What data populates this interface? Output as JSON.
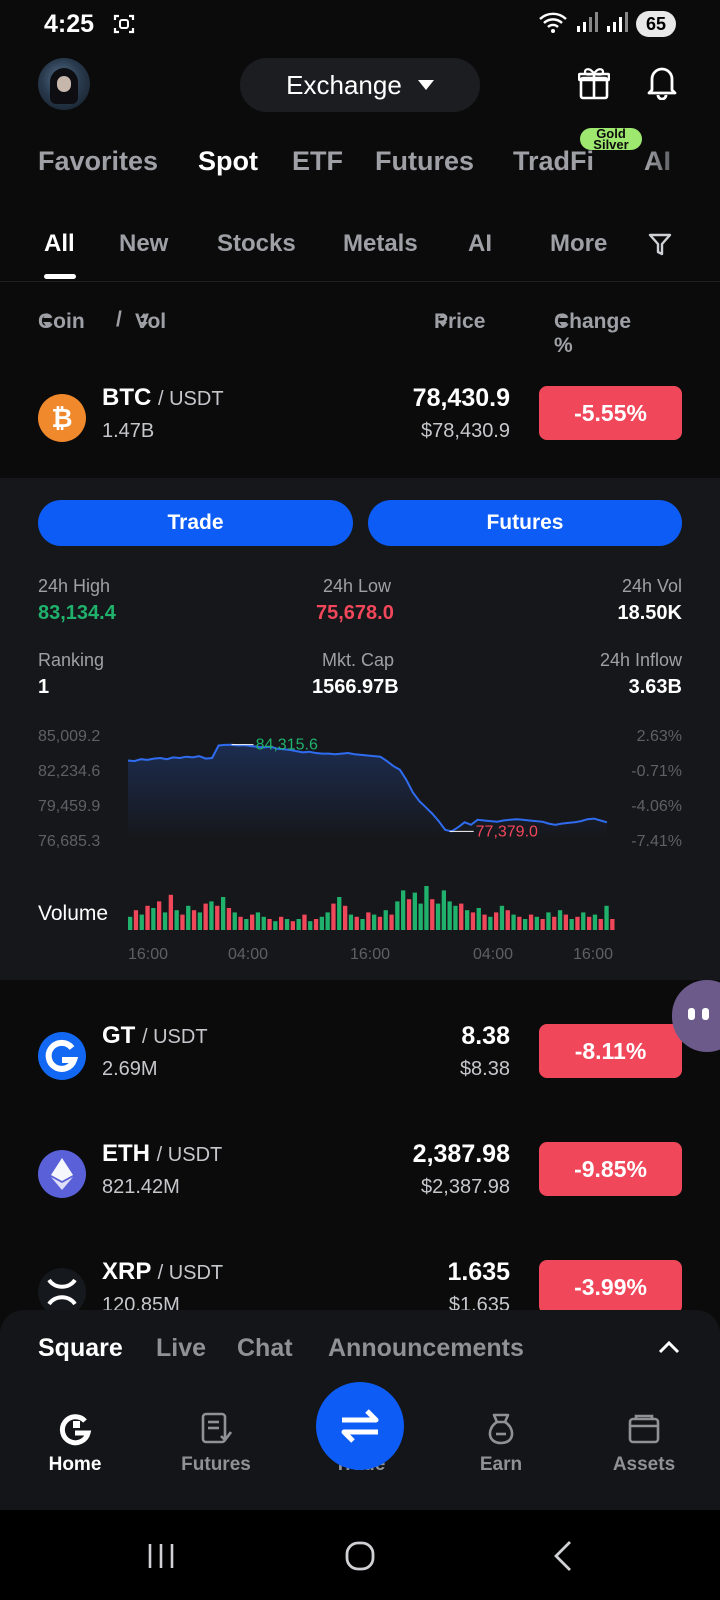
{
  "status_bar": {
    "time": "4:25",
    "battery": "65"
  },
  "header": {
    "exchange_label": "Exchange"
  },
  "main_tabs": [
    {
      "label": "Favorites",
      "active": false
    },
    {
      "label": "Spot",
      "active": true
    },
    {
      "label": "ETF",
      "active": false
    },
    {
      "label": "Futures",
      "active": false
    },
    {
      "label": "TradFi",
      "active": false
    },
    {
      "label": "AI",
      "active": false
    }
  ],
  "tradfi_badge": [
    "Gold",
    "Silver"
  ],
  "sub_tabs": [
    {
      "label": "All",
      "active": true
    },
    {
      "label": "New",
      "active": false
    },
    {
      "label": "Stocks",
      "active": false
    },
    {
      "label": "Metals",
      "active": false
    },
    {
      "label": "AI",
      "active": false
    },
    {
      "label": "More",
      "active": false
    }
  ],
  "columns": {
    "coin": "Coin",
    "separator": "/",
    "vol": "Vol",
    "price": "Price",
    "change": "Change %"
  },
  "rows": [
    {
      "base": "BTC",
      "quote": "/ USDT",
      "vol": "1.47B",
      "price": "78,430.9",
      "price_usd": "$78,430.9",
      "change": "-5.55%"
    },
    {
      "base": "GT",
      "quote": "/ USDT",
      "vol": "2.69M",
      "price": "8.38",
      "price_usd": "$8.38",
      "change": "-8.11%"
    },
    {
      "base": "ETH",
      "quote": "/ USDT",
      "vol": "821.42M",
      "price": "2,387.98",
      "price_usd": "$2,387.98",
      "change": "-9.85%"
    },
    {
      "base": "XRP",
      "quote": "/ USDT",
      "vol": "120.85M",
      "price": "1.635",
      "price_usd": "$1.635",
      "change": "-3.99%"
    }
  ],
  "detail": {
    "trade_label": "Trade",
    "futures_label": "Futures",
    "stats": {
      "high_label": "24h High",
      "high_value": "83,134.4",
      "low_label": "24h Low",
      "low_value": "75,678.0",
      "vol_label": "24h Vol",
      "vol_value": "18.50K",
      "rank_label": "Ranking",
      "rank_value": "1",
      "cap_label": "Mkt. Cap",
      "cap_value": "1566.97B",
      "inflow_label": "24h Inflow",
      "inflow_value": "3.63B"
    },
    "colors": {
      "up": "#20b26c",
      "down": "#f1475a",
      "line": "#2f6cf0"
    }
  },
  "chart_data": {
    "type": "line",
    "series": [
      {
        "values": [
          83050,
          83000,
          83150,
          83100,
          83200,
          83250,
          83150,
          83300,
          83250,
          83350,
          83300,
          83400,
          83200,
          83250,
          84250,
          84300,
          84315.6,
          84250,
          84280,
          84200,
          84150,
          84100,
          84150,
          84000,
          83950,
          83900,
          83800,
          83700,
          83750,
          83650,
          83600,
          83600,
          83550,
          83600,
          83650,
          83550,
          83500,
          83450,
          83400,
          83350,
          83000,
          82600,
          82300,
          81500,
          80500,
          79800,
          79300,
          78800,
          78200,
          77500,
          77379.0,
          77700,
          78100,
          77900,
          78300,
          78250,
          78200,
          78150,
          78250,
          78300,
          78350,
          78300,
          78250,
          78200,
          78150,
          78000,
          77900,
          78000,
          78050,
          78100,
          78200,
          78350,
          78400,
          78250,
          78100
        ]
      }
    ],
    "y_ticks": [
      "85,009.2",
      "82,234.6",
      "79,459.9",
      "76,685.3"
    ],
    "pct_ticks": [
      "2.63%",
      "-0.71%",
      "-4.06%",
      "-7.41%"
    ],
    "ylim": [
      76685.3,
      85009.2
    ],
    "x_ticks": [
      "16:00",
      "04:00",
      "16:00",
      "04:00",
      "16:00"
    ],
    "high_marker": "84,315.6",
    "low_marker": "77,379.0",
    "volume_label": "Volume",
    "volume": [
      {
        "v": 0.3,
        "up": true
      },
      {
        "v": 0.45,
        "up": false
      },
      {
        "v": 0.35,
        "up": true
      },
      {
        "v": 0.55,
        "up": false
      },
      {
        "v": 0.5,
        "up": true
      },
      {
        "v": 0.65,
        "up": false
      },
      {
        "v": 0.4,
        "up": true
      },
      {
        "v": 0.8,
        "up": false
      },
      {
        "v": 0.45,
        "up": true
      },
      {
        "v": 0.35,
        "up": false
      },
      {
        "v": 0.55,
        "up": true
      },
      {
        "v": 0.45,
        "up": false
      },
      {
        "v": 0.4,
        "up": true
      },
      {
        "v": 0.6,
        "up": false
      },
      {
        "v": 0.65,
        "up": true
      },
      {
        "v": 0.55,
        "up": false
      },
      {
        "v": 0.75,
        "up": true
      },
      {
        "v": 0.5,
        "up": false
      },
      {
        "v": 0.4,
        "up": true
      },
      {
        "v": 0.3,
        "up": false
      },
      {
        "v": 0.25,
        "up": true
      },
      {
        "v": 0.35,
        "up": false
      },
      {
        "v": 0.4,
        "up": true
      },
      {
        "v": 0.3,
        "up": true
      },
      {
        "v": 0.25,
        "up": false
      },
      {
        "v": 0.2,
        "up": true
      },
      {
        "v": 0.3,
        "up": false
      },
      {
        "v": 0.25,
        "up": true
      },
      {
        "v": 0.2,
        "up": false
      },
      {
        "v": 0.25,
        "up": true
      },
      {
        "v": 0.35,
        "up": false
      },
      {
        "v": 0.2,
        "up": true
      },
      {
        "v": 0.25,
        "up": false
      },
      {
        "v": 0.3,
        "up": true
      },
      {
        "v": 0.4,
        "up": true
      },
      {
        "v": 0.6,
        "up": false
      },
      {
        "v": 0.75,
        "up": true
      },
      {
        "v": 0.55,
        "up": false
      },
      {
        "v": 0.35,
        "up": true
      },
      {
        "v": 0.3,
        "up": false
      },
      {
        "v": 0.25,
        "up": true
      },
      {
        "v": 0.4,
        "up": false
      },
      {
        "v": 0.35,
        "up": true
      },
      {
        "v": 0.3,
        "up": false
      },
      {
        "v": 0.45,
        "up": true
      },
      {
        "v": 0.35,
        "up": false
      },
      {
        "v": 0.65,
        "up": true
      },
      {
        "v": 0.9,
        "up": true
      },
      {
        "v": 0.7,
        "up": false
      },
      {
        "v": 0.85,
        "up": true
      },
      {
        "v": 0.6,
        "up": true
      },
      {
        "v": 1.0,
        "up": true
      },
      {
        "v": 0.7,
        "up": false
      },
      {
        "v": 0.6,
        "up": true
      },
      {
        "v": 0.9,
        "up": true
      },
      {
        "v": 0.65,
        "up": true
      },
      {
        "v": 0.55,
        "up": true
      },
      {
        "v": 0.6,
        "up": false
      },
      {
        "v": 0.45,
        "up": true
      },
      {
        "v": 0.4,
        "up": false
      },
      {
        "v": 0.5,
        "up": true
      },
      {
        "v": 0.35,
        "up": false
      },
      {
        "v": 0.3,
        "up": true
      },
      {
        "v": 0.4,
        "up": false
      },
      {
        "v": 0.55,
        "up": true
      },
      {
        "v": 0.45,
        "up": false
      },
      {
        "v": 0.35,
        "up": true
      },
      {
        "v": 0.3,
        "up": false
      },
      {
        "v": 0.25,
        "up": true
      },
      {
        "v": 0.35,
        "up": false
      },
      {
        "v": 0.3,
        "up": true
      },
      {
        "v": 0.25,
        "up": false
      },
      {
        "v": 0.4,
        "up": true
      },
      {
        "v": 0.3,
        "up": false
      },
      {
        "v": 0.45,
        "up": true
      },
      {
        "v": 0.35,
        "up": false
      },
      {
        "v": 0.25,
        "up": true
      },
      {
        "v": 0.3,
        "up": false
      },
      {
        "v": 0.4,
        "up": true
      },
      {
        "v": 0.3,
        "up": false
      },
      {
        "v": 0.35,
        "up": true
      },
      {
        "v": 0.25,
        "up": false
      },
      {
        "v": 0.55,
        "up": true
      },
      {
        "v": 0.25,
        "up": false
      }
    ]
  },
  "feed_tabs": [
    {
      "label": "Square",
      "active": true
    },
    {
      "label": "Live",
      "active": false
    },
    {
      "label": "Chat",
      "active": false
    },
    {
      "label": "Announcements",
      "active": false
    }
  ],
  "bottom_nav": [
    {
      "label": "Home",
      "icon": "home-logo-icon",
      "active": true
    },
    {
      "label": "Futures",
      "icon": "futures-doc-icon",
      "active": false
    },
    {
      "label": "Trade",
      "icon": "swap-arrows-icon",
      "active": false
    },
    {
      "label": "Earn",
      "icon": "earn-pot-icon",
      "active": false
    },
    {
      "label": "Assets",
      "icon": "wallet-icon",
      "active": false
    }
  ]
}
